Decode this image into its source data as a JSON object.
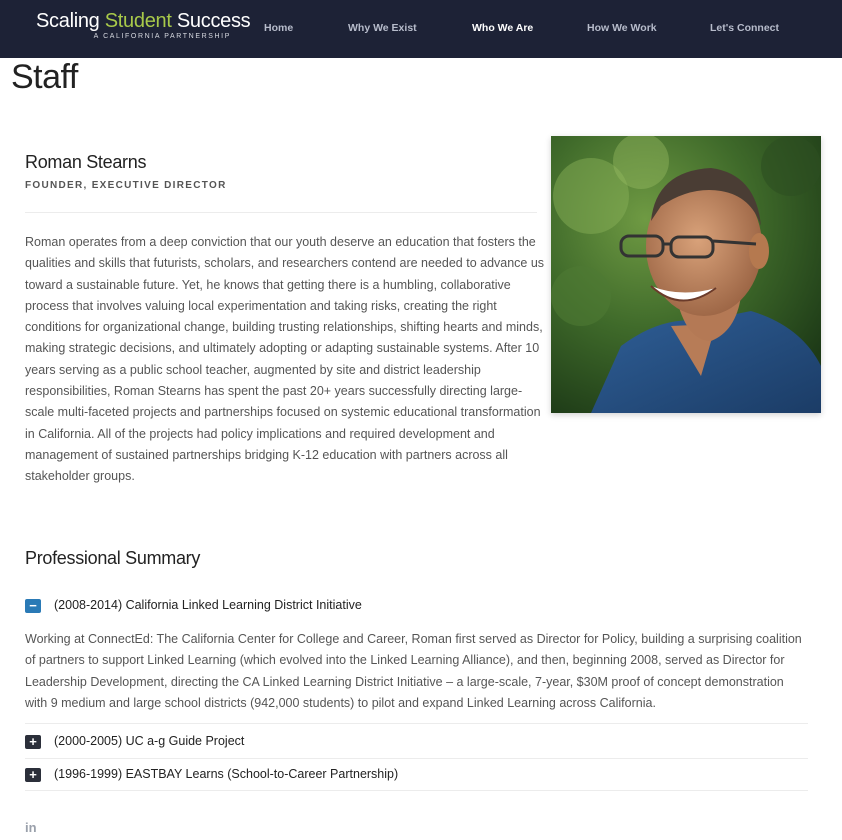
{
  "header": {
    "logo": {
      "main_prefix": "Scaling ",
      "main_accent": "Student",
      "main_suffix": " Success",
      "sub": "A CALIFORNIA PARTNERSHIP"
    },
    "nav": [
      {
        "label": "Home",
        "active": false
      },
      {
        "label": "Why We Exist",
        "active": false
      },
      {
        "label": "Who We Are",
        "active": true
      },
      {
        "label": "How We Work",
        "active": false
      },
      {
        "label": "Let's Connect",
        "active": false
      }
    ]
  },
  "page": {
    "title": "Staff",
    "person": {
      "name": "Roman Stearns",
      "role": "FOUNDER, EXECUTIVE DIRECTOR",
      "bio": "Roman operates from a deep conviction that our youth deserve an education that fosters the qualities and skills that futurists, scholars, and researchers contend are needed to advance us toward a sustainable future. Yet, he knows that getting there is a humbling, collaborative process that involves valuing local experimentation and taking risks, creating the right conditions for organizational change, building trusting relationships, shifting hearts and minds, making strategic decisions, and ultimately adopting or adapting sustainable systems. After 10 years serving as a public school teacher, augmented by site and district leadership responsibilities, Roman Stearns has spent the past 20+ years successfully directing large-scale multi-faceted projects and partnerships focused on systemic educational transformation in California. All of the projects had policy implications and required development and management of sustained partnerships bridging K-12 education with partners across all stakeholder groups."
    },
    "summary": {
      "title": "Professional Summary",
      "items": [
        {
          "title": "(2008-2014) California Linked Learning District Initiative",
          "expanded": true,
          "icon": "−",
          "body": "Working at ConnectEd: The California Center for College and Career, Roman first served as Director for Policy, building a surprising coalition of partners to support Linked Learning (which evolved into the Linked Learning Alliance), and then, beginning 2008, served as Director for Leadership Development, directing the CA Linked Learning District Initiative – a large-scale, 7-year, $30M proof of concept demonstration with 9 medium and large school districts (942,000 students) to pilot and expand Linked Learning across California."
        },
        {
          "title": "(2000-2005) UC a-g Guide Project",
          "expanded": false,
          "icon": "+"
        },
        {
          "title": "(1996-1999) EASTBAY Learns (School-to-Career Partnership)",
          "expanded": false,
          "icon": "+"
        }
      ]
    },
    "social": {
      "linkedin_label": "in"
    }
  },
  "colors": {
    "header_bg": "#1d2236",
    "accent_green": "#a8c94a",
    "toggle_open": "#2a7ab6",
    "toggle_closed": "#2b2f3a"
  }
}
